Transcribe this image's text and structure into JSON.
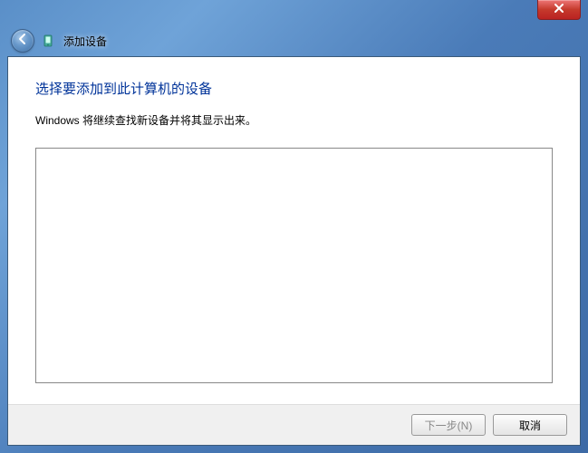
{
  "window": {
    "title": "添加设备"
  },
  "content": {
    "heading": "选择要添加到此计算机的设备",
    "subtext": "Windows 将继续查找新设备并将其显示出来。"
  },
  "buttons": {
    "next_label": "下一步(N)",
    "cancel_label": "取消"
  }
}
